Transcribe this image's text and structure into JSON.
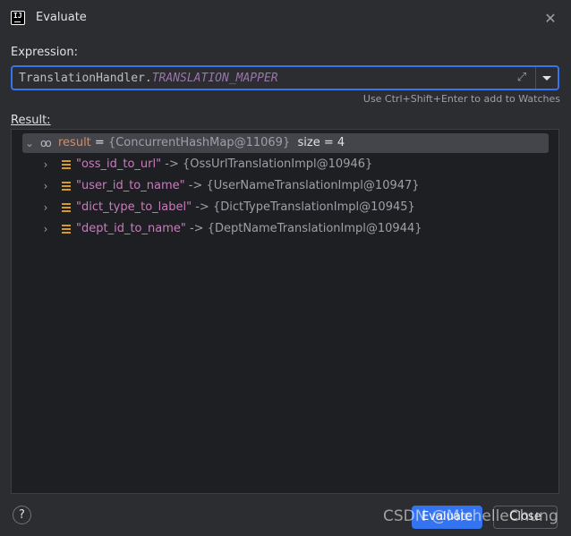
{
  "window": {
    "title": "Evaluate",
    "icon_text": "IJ"
  },
  "expression": {
    "label": "Expression:",
    "value_prefix": "TranslationHandler.",
    "value_const": "TRANSLATION_MAPPER",
    "hint": "Use Ctrl+Shift+Enter to add to Watches"
  },
  "result": {
    "label": "Result:",
    "root": {
      "name": "result",
      "eq": " = ",
      "type": "{ConcurrentHashMap@11069}",
      "size": "size = 4"
    },
    "items": [
      {
        "key": "\"oss_id_to_url\"",
        "arrow": " -> ",
        "value": "{OssUrlTranslationImpl@10946}"
      },
      {
        "key": "\"user_id_to_name\"",
        "arrow": " -> ",
        "value": "{UserNameTranslationImpl@10947}"
      },
      {
        "key": "\"dict_type_to_label\"",
        "arrow": " -> ",
        "value": "{DictTypeTranslationImpl@10945}"
      },
      {
        "key": "\"dept_id_to_name\"",
        "arrow": " -> ",
        "value": "{DeptNameTranslationImpl@10944}"
      }
    ]
  },
  "footer": {
    "help": "?",
    "evaluate_label": "Evaluate",
    "close_label": "Close",
    "watermark": "CSDN @MichelleChung"
  }
}
